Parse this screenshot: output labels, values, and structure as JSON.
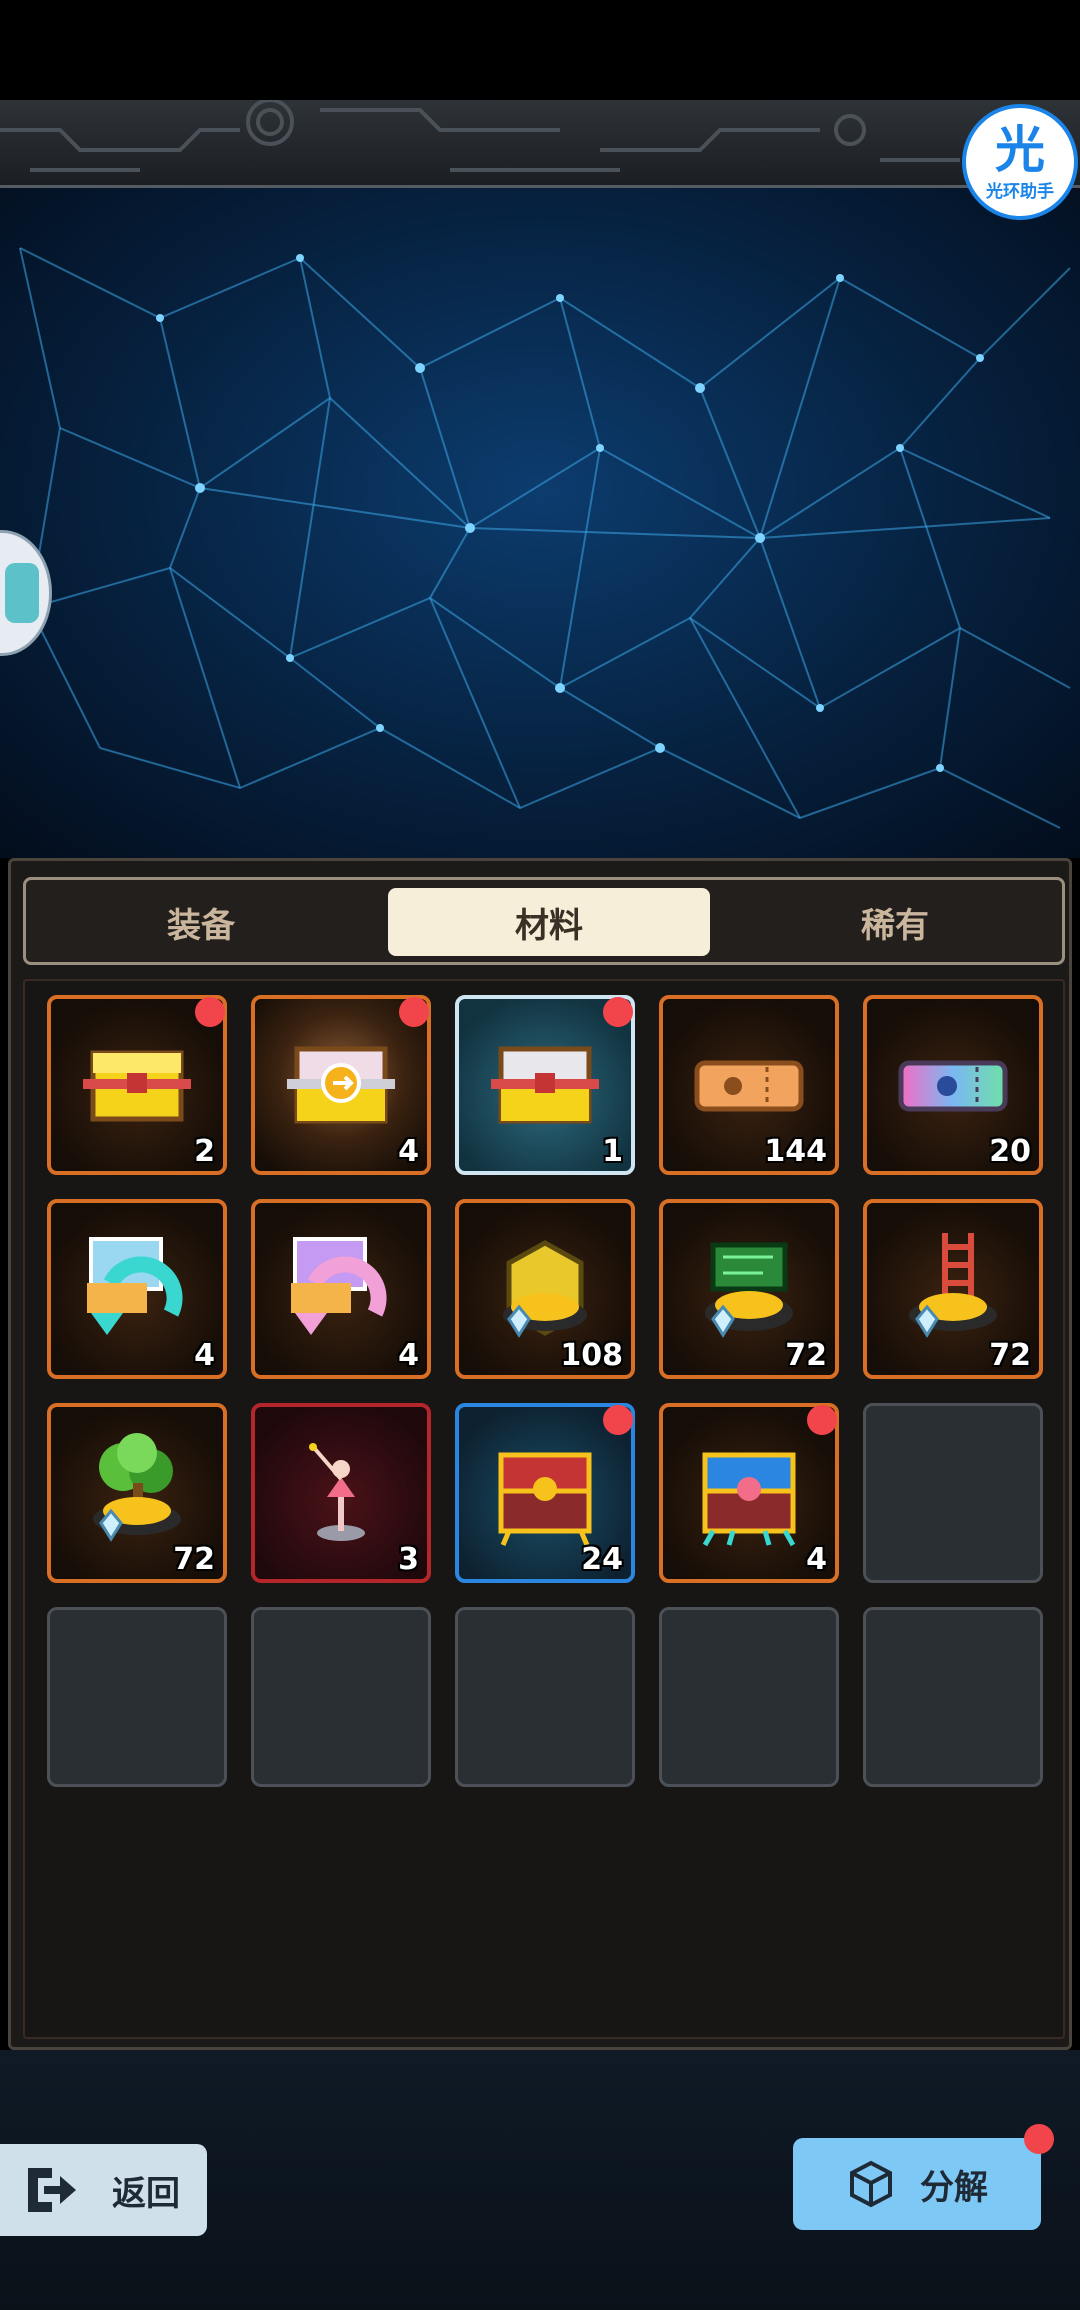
{
  "assistant": {
    "glyph": "光",
    "label": "光环助手"
  },
  "tabs": [
    {
      "label": "装备",
      "active": false
    },
    {
      "label": "材料",
      "active": true
    },
    {
      "label": "稀有",
      "active": false
    }
  ],
  "items": [
    {
      "icon": "yellow-chest-icon",
      "count": "2",
      "badge": true,
      "frame": "orange"
    },
    {
      "icon": "glowing-coin-chest-icon",
      "count": "4",
      "badge": true,
      "frame": "orange-glow"
    },
    {
      "icon": "white-chest-icon",
      "count": "1",
      "badge": true,
      "frame": "selected"
    },
    {
      "icon": "orange-ticket-icon",
      "count": "144",
      "badge": false,
      "frame": "orange"
    },
    {
      "icon": "rainbow-ticket-icon",
      "count": "20",
      "badge": false,
      "frame": "orange"
    },
    {
      "icon": "cyan-recycle-box-icon",
      "count": "4",
      "badge": false,
      "frame": "orange"
    },
    {
      "icon": "pink-recycle-box-icon",
      "count": "4",
      "badge": false,
      "frame": "orange"
    },
    {
      "icon": "gold-crystal-pile-icon",
      "count": "108",
      "badge": false,
      "frame": "orange"
    },
    {
      "icon": "circuit-crystal-pile-icon",
      "count": "72",
      "badge": false,
      "frame": "orange"
    },
    {
      "icon": "ladder-crystal-pile-icon",
      "count": "72",
      "badge": false,
      "frame": "orange"
    },
    {
      "icon": "tree-crystal-pile-icon",
      "count": "72",
      "badge": false,
      "frame": "orange"
    },
    {
      "icon": "dancer-figurine-icon",
      "count": "3",
      "badge": false,
      "frame": "red"
    },
    {
      "icon": "red-treasure-chest-icon",
      "count": "24",
      "badge": true,
      "frame": "blue"
    },
    {
      "icon": "mech-treasure-chest-icon",
      "count": "4",
      "badge": true,
      "frame": "orange"
    }
  ],
  "empty_slots": 6,
  "footer": {
    "back_label": "返回",
    "decompose_label": "分解",
    "decompose_badge": true
  },
  "colors": {
    "frame_orange": "#d86f24",
    "frame_blue": "#2a86e0",
    "frame_red": "#b4262a",
    "badge_red": "#f2444b",
    "tab_active_bg": "#f6eed9",
    "decompose_bg": "#7ec8f5"
  }
}
